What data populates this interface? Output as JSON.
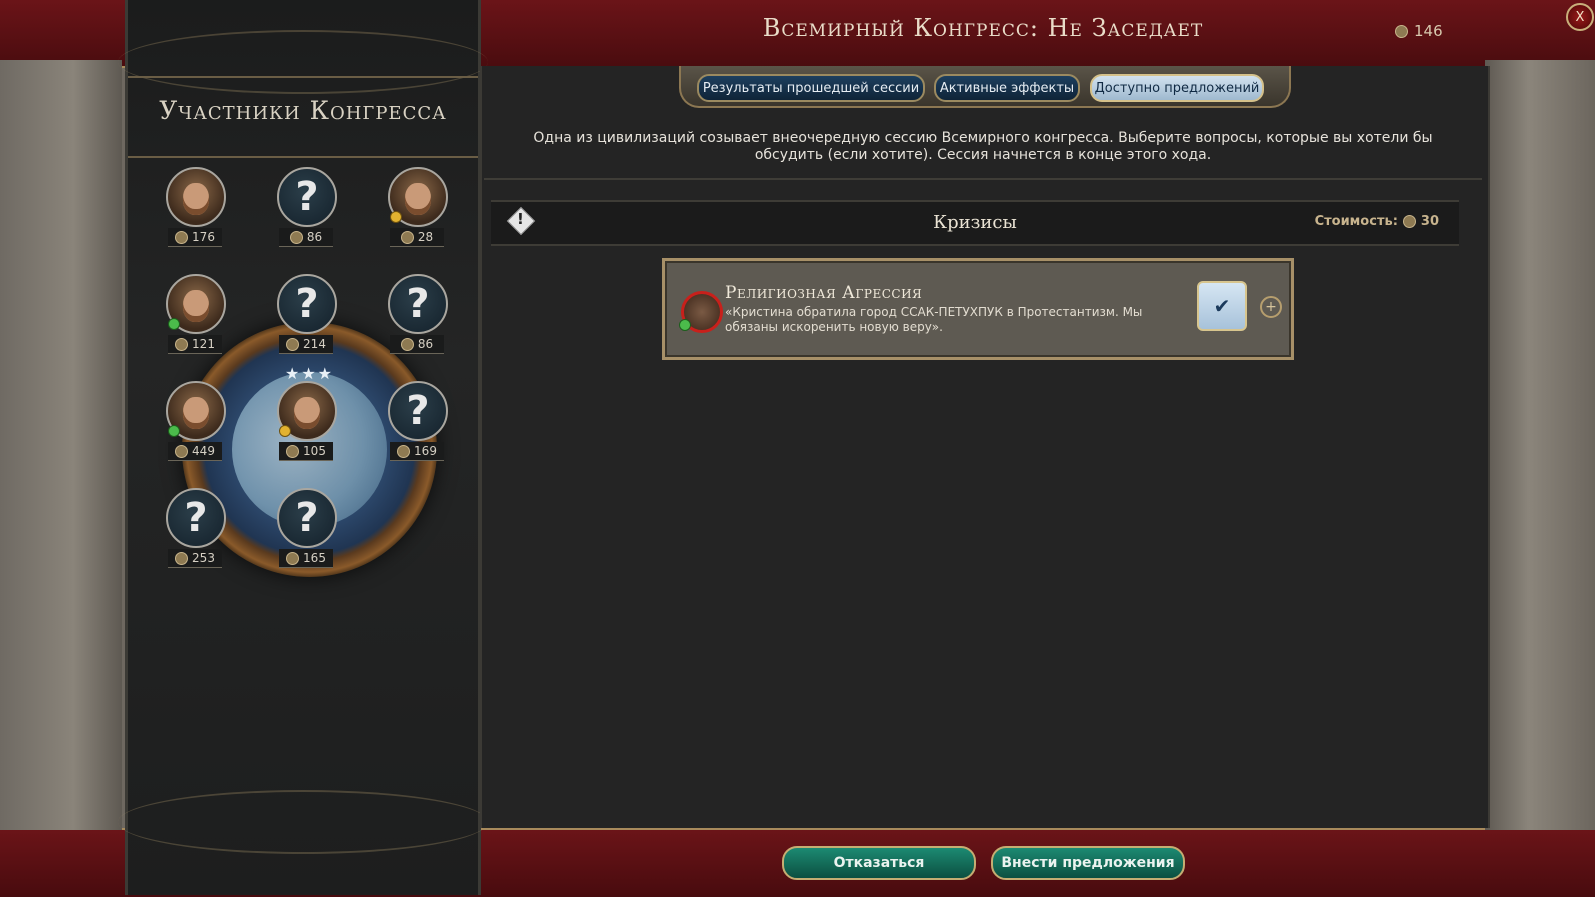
{
  "header": {
    "title": "Всемирный Конгресс: Не Заседает",
    "favor": "146",
    "close_label": "X"
  },
  "tabs": [
    {
      "label": "Результаты прошедшей сессии",
      "active": false
    },
    {
      "label": "Активные эффекты",
      "active": false
    },
    {
      "label": "Доступно предложений",
      "active": true
    }
  ],
  "left_panel": {
    "title": "Участники Конгресса",
    "members": [
      {
        "favor": "176",
        "known": true
      },
      {
        "favor": "86",
        "known": false
      },
      {
        "favor": "28",
        "known": true
      },
      {
        "favor": "121",
        "known": true
      },
      {
        "favor": "214",
        "known": false
      },
      {
        "favor": "86",
        "known": false
      },
      {
        "favor": "449",
        "known": true
      },
      {
        "favor": "105",
        "known": true
      },
      {
        "favor": "169",
        "known": false
      },
      {
        "favor": "253",
        "known": false
      },
      {
        "favor": "165",
        "known": false
      }
    ],
    "unknown_glyph": "?"
  },
  "description": "Одна из цивилизаций созывает внеочередную сессию Всемирного конгресса. Выберите вопросы, которые вы хотели бы обсудить (если хотите). Сессия начнется в конце этого хода.",
  "section": {
    "title": "Кризисы",
    "cost_label": "Стоимость:",
    "cost_value": "30"
  },
  "proposal": {
    "title": "Религиозная Агрессия",
    "text": "«Кристина обратила город ССАК-ПЕТУХПУК в Протестантизм. Мы обязаны искоренить новую веру».",
    "selected": true
  },
  "buttons": {
    "decline": "Отказаться",
    "submit": "Внести предложения"
  },
  "icons": [
    "globe-icon",
    "congress-icon",
    "favor-icon",
    "crisis-icon",
    "check-icon",
    "add-icon",
    "close-icon"
  ],
  "colors": {
    "accent_red": "#6b1418",
    "gold_border": "#a88a5c",
    "button_green": "#1c8a72",
    "active_tab": "#d2e2ef"
  }
}
